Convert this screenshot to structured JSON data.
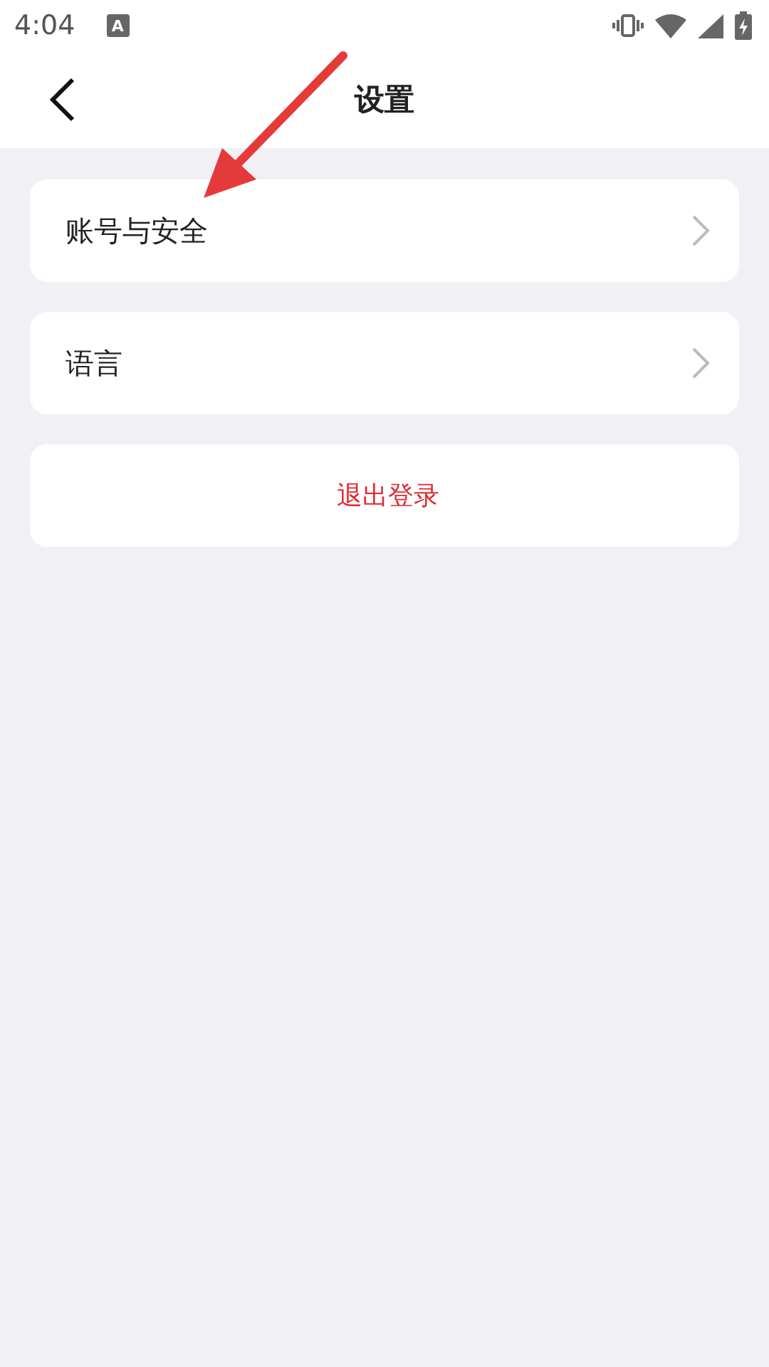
{
  "status_bar": {
    "time": "4:04",
    "notification": "A"
  },
  "header": {
    "title": "设置"
  },
  "items": [
    {
      "kind": "link",
      "label": "账号与安全"
    },
    {
      "kind": "link",
      "label": "语言"
    },
    {
      "kind": "danger",
      "label": "退出登录"
    }
  ],
  "annotation": {
    "kind": "arrow"
  }
}
